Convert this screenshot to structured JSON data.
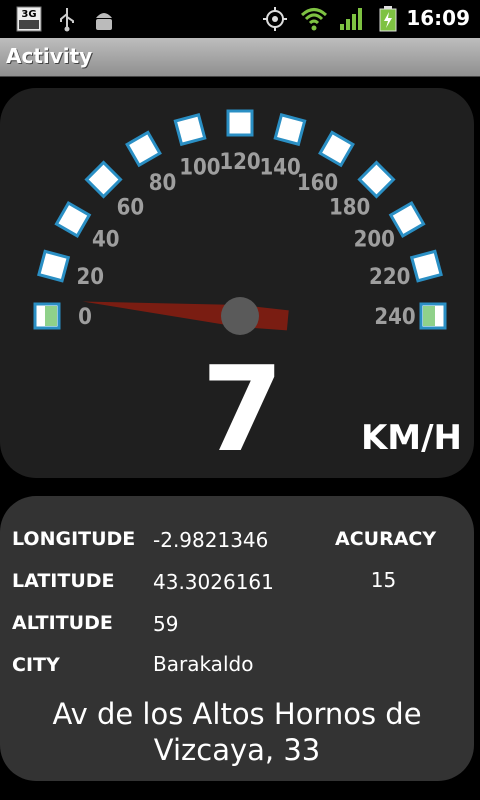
{
  "statusbar": {
    "network_badge": "3G",
    "icons": [
      "3g-icon",
      "usb-icon",
      "android-debug-icon",
      "gps-icon",
      "wifi-icon",
      "signal-icon",
      "battery-charging-icon"
    ],
    "time": "16:09"
  },
  "titlebar": {
    "title": "Activity"
  },
  "gauge": {
    "ticks": [
      "0",
      "20",
      "40",
      "60",
      "80",
      "100",
      "120",
      "140",
      "160",
      "180",
      "200",
      "220",
      "240"
    ],
    "max": 240,
    "speed": 7,
    "unit": "KM/H"
  },
  "info": {
    "longitude_label": "LONGITUDE",
    "longitude_value": "-2.9821346",
    "latitude_label": "LATITUDE",
    "latitude_value": "43.3026161",
    "altitude_label": "ALTITUDE",
    "altitude_value": "59",
    "city_label": "CITY",
    "city_value": "Barakaldo",
    "accuracy_label": "ACURACY",
    "accuracy_value": "15",
    "address": "Av de los Altos Hornos de Vizcaya, 33"
  }
}
